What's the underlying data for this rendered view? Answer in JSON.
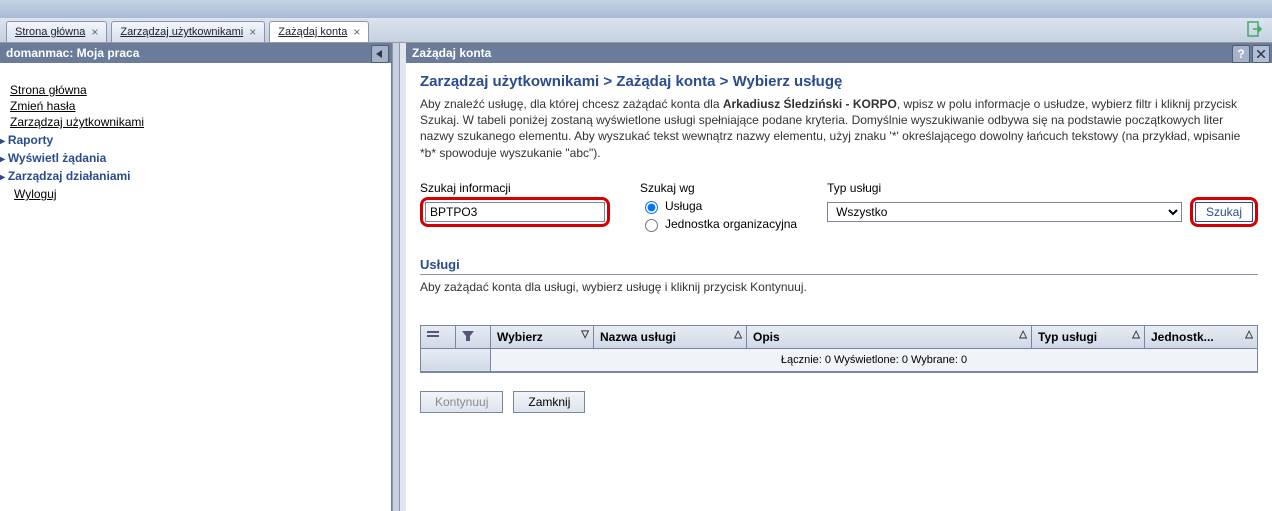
{
  "tabs": [
    {
      "label": "Strona główna"
    },
    {
      "label": "Zarządzaj użytkownikami"
    },
    {
      "label": "Zażądaj konta"
    }
  ],
  "active_tab": 2,
  "sidebar": {
    "title": "domanmac: Moja praca",
    "links": [
      {
        "label": "Strona główna"
      },
      {
        "label": "Zmień hasła"
      },
      {
        "label": "Zarządzaj użytkownikami"
      }
    ],
    "sections": [
      {
        "label": "Raporty"
      },
      {
        "label": "Wyświetl żądania"
      },
      {
        "label": "Zarządzaj działaniami"
      }
    ],
    "logout": "Wyloguj"
  },
  "panel": {
    "title": "Zażądaj konta",
    "breadcrumb": "Zarządzaj użytkownikami > Zażądaj konta > Wybierz usługę",
    "desc_pre": "Aby znaleźć usługę, dla której chcesz zażądać konta dla ",
    "desc_bold": "Arkadiusz Śledziński - KORPO",
    "desc_post": ", wpisz w polu informacje o usłudze, wybierz filtr i kliknij przycisk Szukaj. W tabeli poniżej zostaną wyświetlone usługi spełniające podane kryteria. Domyślnie wyszukiwanie odbywa się na podstawie początkowych liter nazwy szukanego elementu. Aby wyszukać tekst wewnątrz nazwy elementu, użyj znaku '*' określającego dowolny łańcuch tekstowy (na przykład, wpisanie *b* spowoduje wyszukanie \"abc\")."
  },
  "search": {
    "info_label": "Szukaj informacji",
    "info_value": "BPTPO3",
    "by_label": "Szukaj wg",
    "by_opt1": "Usługa",
    "by_opt2": "Jednostka organizacyjna",
    "type_label": "Typ usługi",
    "type_value": "Wszystko",
    "button": "Szukaj"
  },
  "services": {
    "title": "Usługi",
    "subtitle": "Aby zażądać konta dla usługi, wybierz usługę i kliknij przycisk Kontynuuj."
  },
  "table": {
    "cols": [
      "Wybierz",
      "Nazwa usługi",
      "Opis",
      "Typ usługi",
      "Jednostk..."
    ],
    "summary": "Łącznie: 0   Wyświetlone: 0   Wybrane: 0"
  },
  "buttons": {
    "continue": "Kontynuuj",
    "close": "Zamknij"
  }
}
